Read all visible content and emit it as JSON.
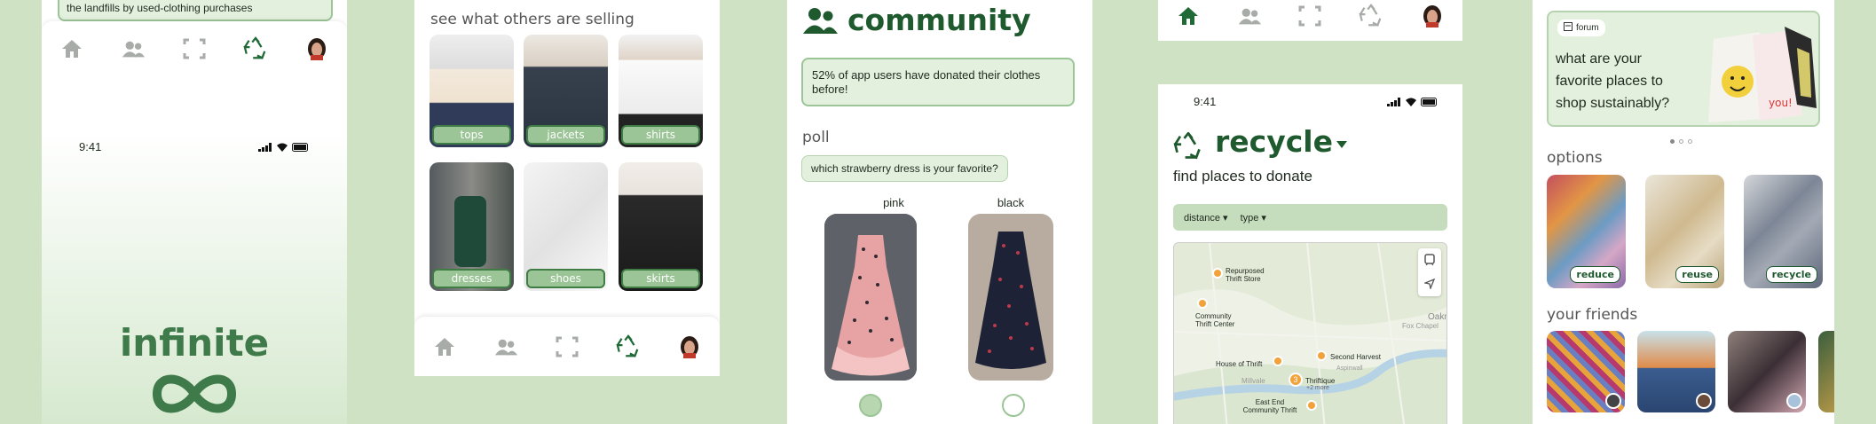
{
  "colors": {
    "accent": "#1f5a2f",
    "background": "#cfe3c4",
    "pill": "#9bc596"
  },
  "nav": {
    "icons": [
      "home-icon",
      "friends-icon",
      "scan-icon",
      "recycle-icon",
      "profile-avatar"
    ]
  },
  "screen1": {
    "banner_text": "the landfills by used-clothing purchases",
    "status_time": "9:41",
    "splash_title": "infinite"
  },
  "screen2": {
    "heading": "see what others are selling",
    "categories": [
      "tops",
      "jackets",
      "shirts",
      "dresses",
      "shoes",
      "skirts"
    ]
  },
  "screen3": {
    "title": "community",
    "stat_text": "52% of app users have donated their clothes before!",
    "poll_label": "poll",
    "poll_question": "which strawberry dress is your favorite?",
    "options": [
      "pink",
      "black"
    ]
  },
  "screen4": {
    "status_time": "9:41",
    "title": "recycle",
    "subtitle": "find places to donate",
    "filters": [
      "distance",
      "type"
    ],
    "map_labels": [
      "Repurposed Thrift Store",
      "Community Thrift Center",
      "House of Thrift",
      "Second Harvest",
      "Thriftique",
      "+2 more",
      "East End Community Thrift",
      "Oakm",
      "Fox Chapel",
      "Millvale",
      "Aspinwall"
    ]
  },
  "screen5": {
    "forum_badge": "forum",
    "forum_question": "what are your favorite places to shop sustainably?",
    "options_heading": "options",
    "options": [
      "reduce",
      "reuse",
      "recycle"
    ],
    "friends_heading": "your friends"
  }
}
